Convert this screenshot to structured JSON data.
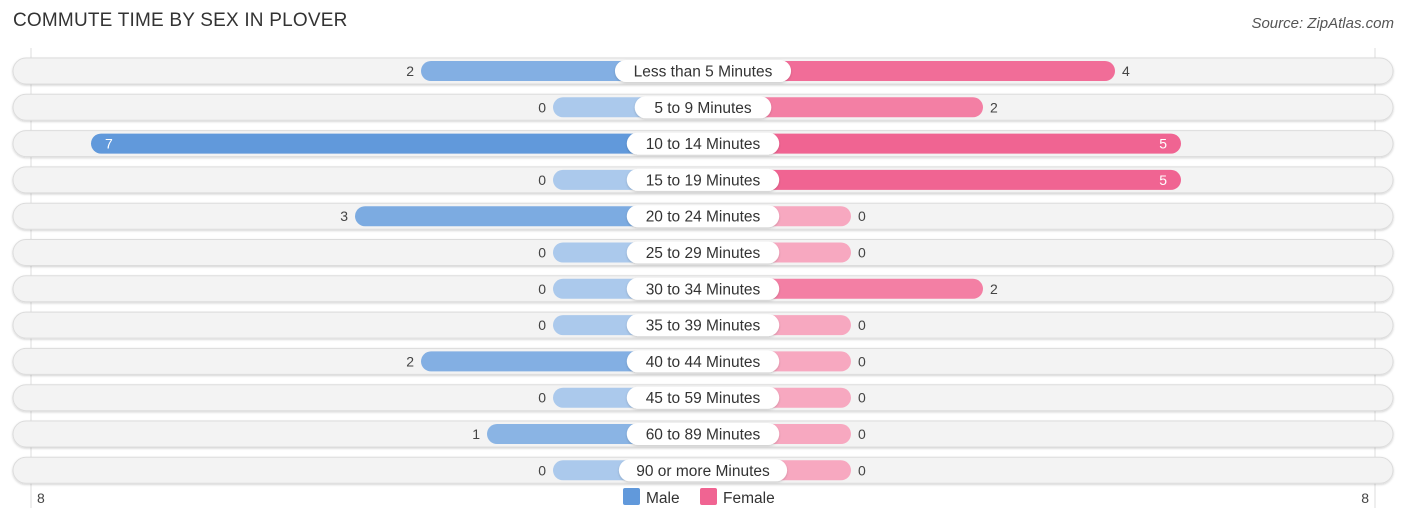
{
  "chart_data": {
    "type": "bar",
    "orientation": "horizontal-diverging",
    "title": "COMMUTE TIME BY SEX IN PLOVER",
    "source": "Source: ZipAtlas.com",
    "categories": [
      "Less than 5 Minutes",
      "5 to 9 Minutes",
      "10 to 14 Minutes",
      "15 to 19 Minutes",
      "20 to 24 Minutes",
      "25 to 29 Minutes",
      "30 to 34 Minutes",
      "35 to 39 Minutes",
      "40 to 44 Minutes",
      "45 to 59 Minutes",
      "60 to 89 Minutes",
      "90 or more Minutes"
    ],
    "series": [
      {
        "name": "Male",
        "color": "#6199db",
        "light_color": "#abc9ec",
        "values": [
          2,
          0,
          7,
          0,
          3,
          0,
          0,
          0,
          2,
          0,
          1,
          0
        ]
      },
      {
        "name": "Female",
        "color": "#f06492",
        "light_color": "#f7a8c0",
        "values": [
          4,
          2,
          5,
          5,
          0,
          0,
          2,
          0,
          0,
          0,
          0,
          0
        ]
      }
    ],
    "axis": {
      "left_label": "8",
      "right_label": "8",
      "max": 8
    },
    "legend": {
      "position": "bottom-center",
      "items": [
        "Male",
        "Female"
      ]
    }
  }
}
